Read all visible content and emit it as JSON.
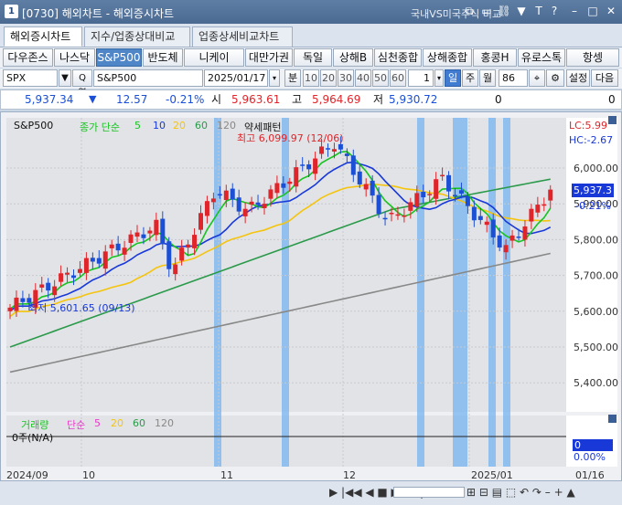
{
  "titlebar": {
    "window_num": "1",
    "title": "[0730] 해외차트 - 해외증시차트",
    "link": "국내VS미국주식 비교",
    "btn_icons": [
      "copy-icon",
      "window-icon",
      "link-icon",
      "pin-icon",
      "help-icon",
      "minimize-icon",
      "maximize-icon",
      "close-icon"
    ],
    "btn_glyphs": [
      "⧉",
      "▭",
      "⛓",
      "▼",
      "T",
      "?",
      "–",
      "□",
      "✕"
    ]
  },
  "tabs": [
    "해외증시차트",
    "지수/업종상대비교",
    "업종상세비교차트"
  ],
  "index_buttons": [
    "다우존스",
    "나스닥",
    "S&P500",
    "반도체",
    "니케이",
    "대만가권",
    "독일",
    "상해B",
    "심천종합",
    "상해종합",
    "홍콩H",
    "유로스톡",
    "항셍"
  ],
  "selected_index": "S&P500",
  "controls": {
    "symbol": "SPX",
    "symbol_suffix": "Q 열",
    "name": "S&P500",
    "date": "2025/01/17",
    "minute": "분",
    "intervals": [
      "10",
      "20",
      "30",
      "40",
      "50",
      "60"
    ],
    "interval_value": "1",
    "periods": [
      "일",
      "주",
      "월"
    ],
    "count": "86",
    "settings": "설정",
    "next": "다음"
  },
  "quote": {
    "price": "5,937.34",
    "arrow": "▼",
    "change": "12.57",
    "change_pct": "-0.21%",
    "open_label": "시",
    "open": "5,963.61",
    "high_label": "고",
    "high": "5,964.69",
    "low_label": "저",
    "low": "5,930.72",
    "vol1": "0",
    "vol2": "0"
  },
  "chart": {
    "symbol_label": "S&P500",
    "ma_label": "종가 단순",
    "ma_periods": [
      "5",
      "10",
      "20",
      "60",
      "120"
    ],
    "pattern_label": "약세패턴",
    "high_note": "최고 6,099.97 (12/06)",
    "low_note": "최저 5,601.65 (09/13)",
    "lc_label": "LC:5.99",
    "hc_label": "HC:-2.67",
    "price_box": "5,937.3",
    "pct_label": "-0.21%",
    "y_ticks": [
      "6,000.00",
      "5,900.00",
      "5,800.00",
      "5,700.00",
      "5,600.00",
      "5,500.00",
      "5,400.00"
    ],
    "volume_label": "거래량",
    "volume_ma": "단순",
    "volume_periods": [
      "5",
      "20",
      "60",
      "120"
    ],
    "volume_value": "0주(N/A)",
    "volume_box": "0",
    "volume_pct": "0.00%",
    "x_ticks": [
      "2024/09",
      "10",
      "11",
      "12",
      "2025/01"
    ],
    "x_right": "01/16",
    "colors": {
      "up": "#e0252a",
      "down": "#1a4fd6",
      "ma5": "#17c421",
      "ma10": "#1838d8",
      "ma20": "#f5c40d",
      "ma60": "#2a9a4a",
      "ma120": "#888888",
      "highlight": "#7db6f0"
    }
  }
}
